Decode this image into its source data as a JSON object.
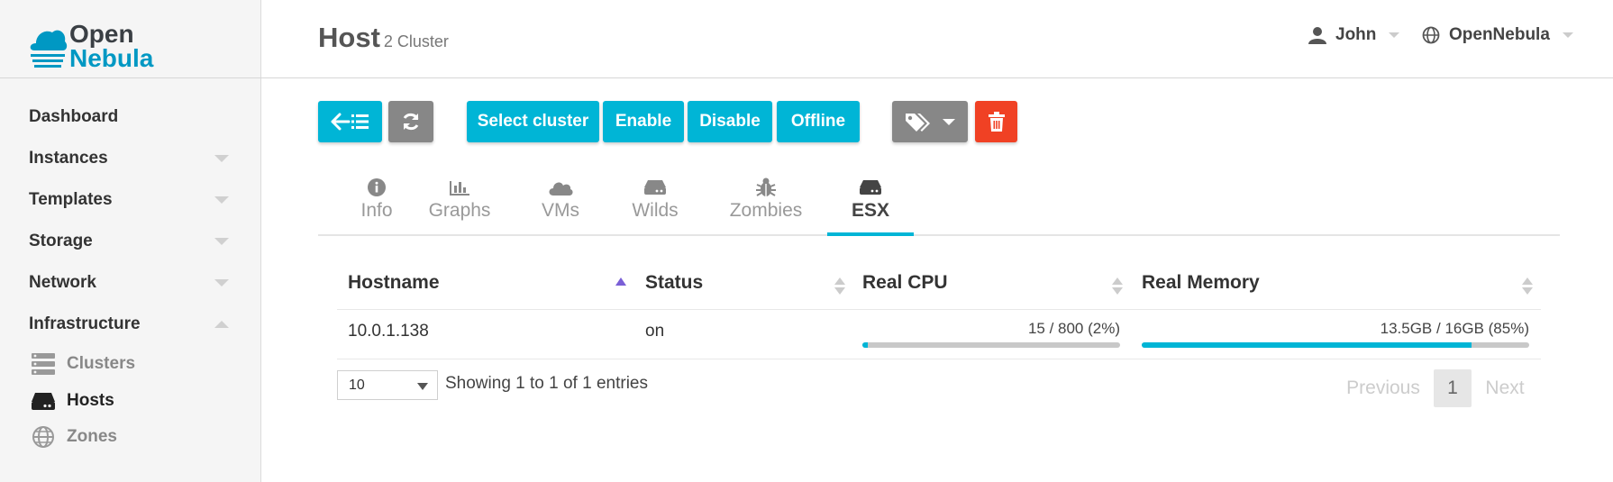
{
  "brand": {
    "line1": "Open",
    "line2": "Nebula"
  },
  "sidebar": {
    "items": [
      {
        "label": "Dashboard"
      },
      {
        "label": "Instances"
      },
      {
        "label": "Templates"
      },
      {
        "label": "Storage"
      },
      {
        "label": "Network"
      },
      {
        "label": "Infrastructure"
      }
    ],
    "subitems": [
      {
        "label": "Clusters",
        "icon": "server-stack-icon"
      },
      {
        "label": "Hosts",
        "icon": "hard-drive-icon"
      },
      {
        "label": "Zones",
        "icon": "globe-icon"
      }
    ]
  },
  "header": {
    "title": "Host",
    "subtitle": "2 Cluster",
    "user": "John",
    "zone": "OpenNebula"
  },
  "toolbar": {
    "select_cluster": "Select cluster",
    "enable": "Enable",
    "disable": "Disable",
    "offline": "Offline"
  },
  "tabs": [
    {
      "label": "Info",
      "icon": "info-icon"
    },
    {
      "label": "Graphs",
      "icon": "bar-chart-icon"
    },
    {
      "label": "VMs",
      "icon": "cloud-icon"
    },
    {
      "label": "Wilds",
      "icon": "hdd-icon"
    },
    {
      "label": "Zombies",
      "icon": "bug-icon"
    },
    {
      "label": "ESX",
      "icon": "hdd-icon"
    }
  ],
  "table": {
    "columns": [
      "Hostname",
      "Status",
      "Real CPU",
      "Real Memory"
    ],
    "rows": [
      {
        "hostname": "10.0.1.138",
        "status": "on",
        "cpu_label": "15 / 800 (2%)",
        "cpu_fraction": 0.02,
        "mem_label": "13.5GB / 16GB (85%)",
        "mem_fraction": 0.85
      }
    ]
  },
  "footer": {
    "page_size": "10",
    "showing": "Showing 1 to 1 of 1 entries",
    "previous": "Previous",
    "current_page": "1",
    "next": "Next"
  },
  "colors": {
    "accent": "#00b5d6",
    "gray_button": "#878787",
    "danger": "#f04124",
    "brand_dark": "#3a3f44",
    "brand_blue": "#0098c3"
  }
}
